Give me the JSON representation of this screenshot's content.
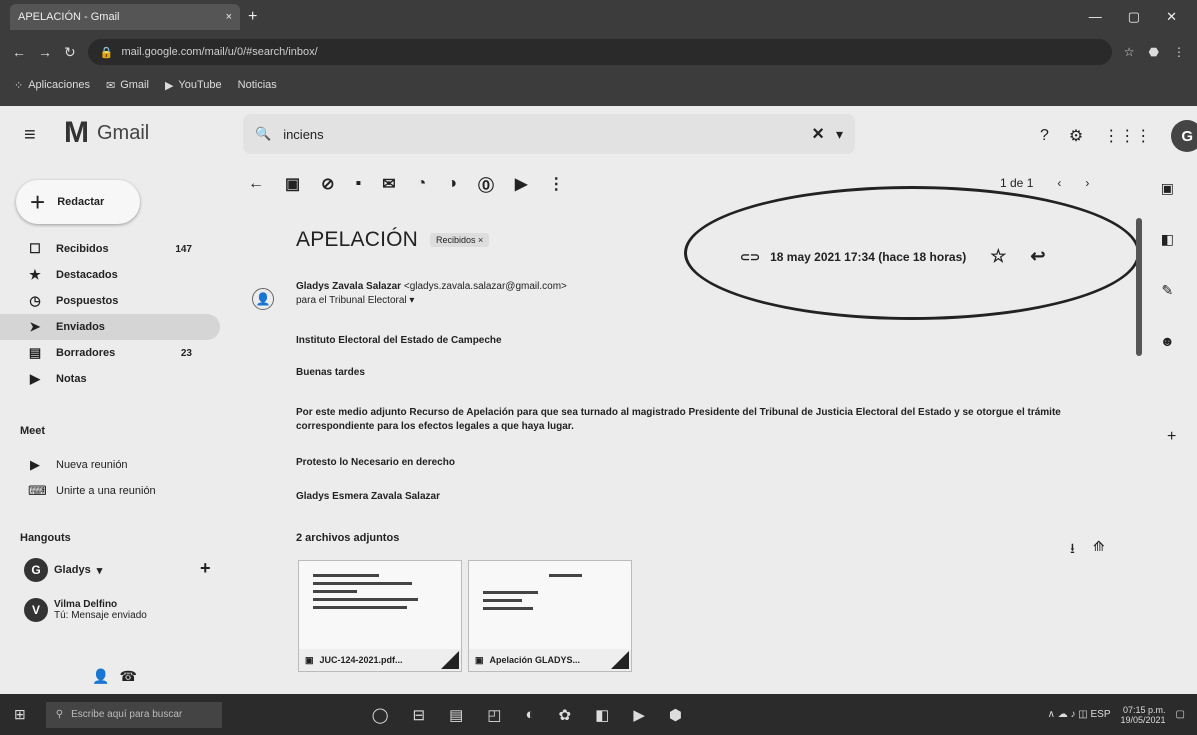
{
  "browser": {
    "tab_title": "APELACIÓN - Gmail",
    "tab_close": "×",
    "new_tab": "+",
    "window_controls": [
      "—",
      "▢",
      "✕"
    ],
    "address": "mail.google.com/mail/u/0/#search/inbox/",
    "bookmarks": [
      "Aplicaciones",
      "Gmail",
      "YouTube",
      "Noticias"
    ]
  },
  "gmail": {
    "menu_icon": "≡",
    "logo_mark": "M",
    "logo_text": "Gmail",
    "search_value": "inciens",
    "search_clear": "×",
    "search_options": "▾",
    "header_icons": [
      "?",
      "⚙",
      "⋮⋮⋮"
    ],
    "avatar_letter": "G"
  },
  "sidebar": {
    "compose_label": "Redactar",
    "items": [
      {
        "icon": "☐",
        "label": "Recibidos",
        "count": "147"
      },
      {
        "icon": "★",
        "label": "Destacados",
        "count": ""
      },
      {
        "icon": "◷",
        "label": "Pospuestos",
        "count": ""
      },
      {
        "icon": "➤",
        "label": "Enviados",
        "count": ""
      },
      {
        "icon": "▤",
        "label": "Borradores",
        "count": "23"
      },
      {
        "icon": "▶",
        "label": "Notas",
        "count": ""
      }
    ],
    "meet_title": "Meet",
    "meet_items": [
      {
        "icon": "▶",
        "label": "Nueva reunión"
      },
      {
        "icon": "⌨",
        "label": "Unirte a una reunión"
      }
    ],
    "hangouts_title": "Hangouts",
    "hangouts_user": {
      "initial": "G",
      "name": "Gladys",
      "arrow": "▾",
      "add": "+"
    },
    "hangouts_contact": {
      "initial": "V",
      "name": "Vilma Delfino",
      "status": "Tú: Mensaje enviado"
    },
    "bottom_icons": [
      "👤",
      "☎"
    ]
  },
  "toolbar": {
    "back": "←",
    "actions": [
      "▣",
      "⊘",
      "▪",
      "✉",
      "◔",
      "◑",
      "⓪",
      "▶",
      "⋮"
    ],
    "pager": [
      "1 de 1",
      "‹",
      "›"
    ]
  },
  "message": {
    "subject": "APELACIÓN",
    "label": "Recibidos ×",
    "sender_name": "Gladys Zavala Salazar",
    "sender_email": "<gladys.zavala.salazar@gmail.com>",
    "to_line": "para el Tribunal Electoral ▾",
    "date": "18 may 2021 17:34 (hace 18 horas)",
    "attach_icon": "⊂⊃",
    "star_icon": "☆",
    "reply_icon": "↩",
    "recipient_line": "Instituto Electoral del Estado de Campeche",
    "greeting": "Buenas tardes",
    "paragraph": "Por este medio adjunto Recurso de Apelación para que sea turnado al magistrado Presidente del Tribunal de Justicia Electoral del Estado y se otorgue el trámite correspondiente para los efectos legales a que haya lugar.",
    "closing": "Protesto lo Necesario en derecho",
    "signature": "Gladys Esmera Zavala Salazar",
    "attachments_title": "2 archivos adjuntos",
    "attachment_icons": [
      "⭳",
      "⟰"
    ],
    "attachments": [
      {
        "name": "JUC-124-2021.pdf...",
        "icon": "▣"
      },
      {
        "name": "Apelación GLADYS...",
        "icon": "▣"
      }
    ]
  },
  "right_rail": [
    "▣",
    "◧",
    "✎",
    "☻"
  ],
  "right_rail_plus": "+",
  "taskbar": {
    "start": "⊞",
    "search_placeholder": "Escribe aquí para buscar",
    "apps": [
      "◯",
      "⊟",
      "▤",
      "◰",
      "◐",
      "✿",
      "◧",
      "▶",
      "⬢"
    ],
    "tray_icons": "∧ ☁ ♪ ◫ ESP",
    "time": "07:15 p.m.",
    "date": "19/05/2021",
    "notif": "▢"
  }
}
